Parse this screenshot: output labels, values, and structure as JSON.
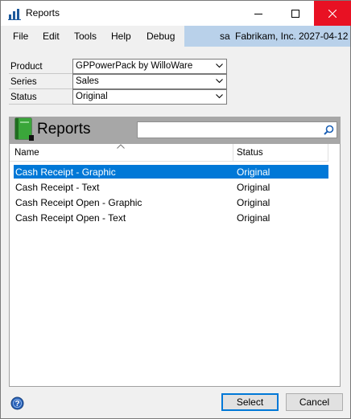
{
  "window": {
    "title": "Reports"
  },
  "menu": {
    "items": [
      "File",
      "Edit",
      "Tools",
      "Help",
      "Debug"
    ],
    "user": "sa",
    "company": "Fabrikam, Inc.",
    "date": "2027-04-12"
  },
  "filters": {
    "product": {
      "label": "Product",
      "value": "GPPowerPack by WilloWare"
    },
    "series": {
      "label": "Series",
      "value": "Sales"
    },
    "status": {
      "label": "Status",
      "value": "Original"
    }
  },
  "panel": {
    "title": "Reports",
    "search_value": ""
  },
  "list": {
    "columns": [
      "Name",
      "Status"
    ],
    "rows": [
      {
        "name": "Cash Receipt - Graphic",
        "status": "Original",
        "selected": true
      },
      {
        "name": "Cash Receipt - Text",
        "status": "Original",
        "selected": false
      },
      {
        "name": "Cash Receipt Open - Graphic",
        "status": "Original",
        "selected": false
      },
      {
        "name": "Cash Receipt Open - Text",
        "status": "Original",
        "selected": false
      }
    ]
  },
  "buttons": {
    "select": "Select",
    "cancel": "Cancel"
  },
  "colors": {
    "selection": "#0078d7",
    "close_button": "#e81123",
    "status_bar": "#b9d1ea",
    "panel_header": "#a7a7a7",
    "book_icon": "#3aa63a"
  },
  "icons": [
    "app-chart-icon",
    "minimize-icon",
    "maximize-icon",
    "close-icon",
    "book-icon",
    "search-icon",
    "sort-up-icon",
    "chevron-down-icon",
    "help-icon"
  ]
}
